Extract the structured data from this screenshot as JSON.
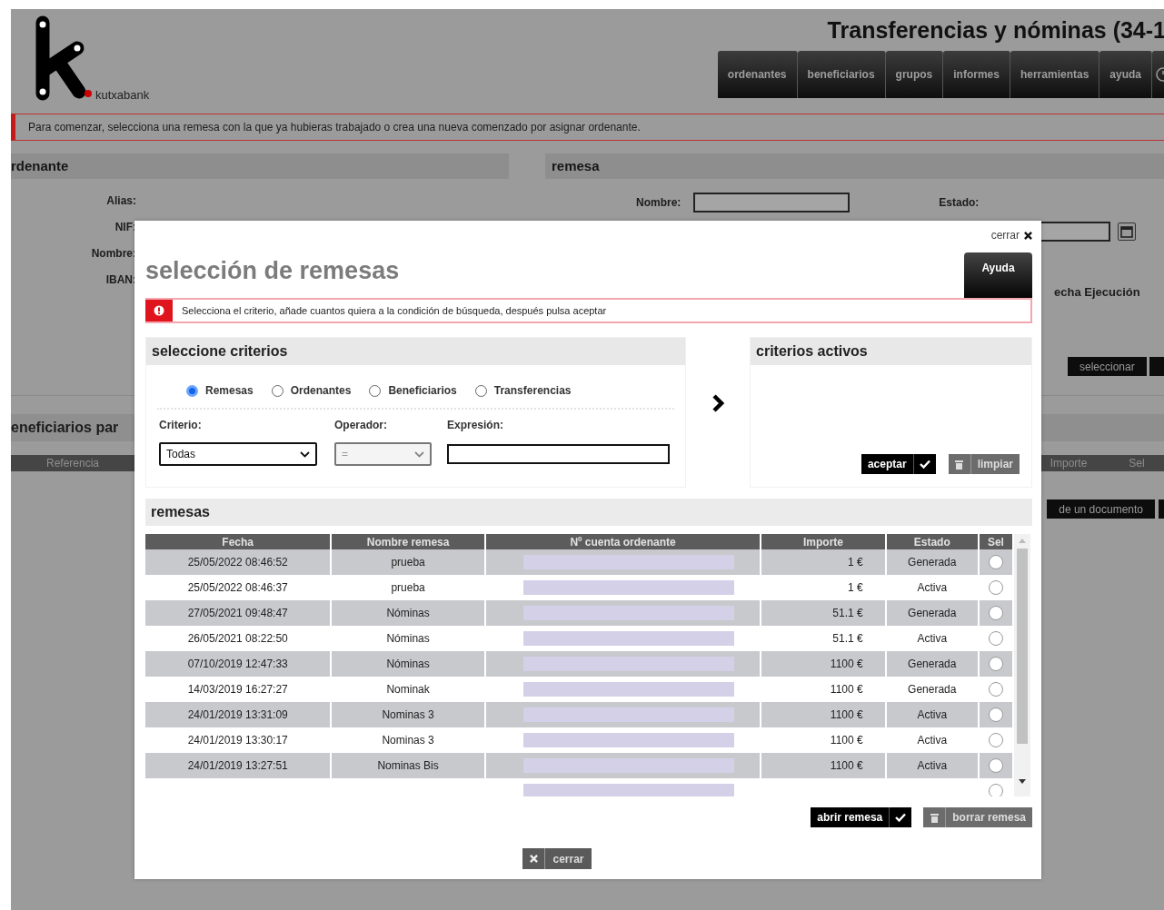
{
  "page": {
    "logo_text": "kutxabank",
    "title": "Transferencias y nóminas (34-1",
    "nav": [
      "ordenantes",
      "beneficiarios",
      "grupos",
      "informes",
      "herramientas",
      "ayuda"
    ],
    "notice": "Para comenzar, selecciona una remesa con la que ya hubieras trabajado o crea una nueva comenzado por asignar ordenante.",
    "ordenante": {
      "title": "rdenante",
      "labels": [
        "Alias:",
        "NIF:",
        "Nombre:",
        "IBAN:"
      ]
    },
    "remesa": {
      "title": "remesa",
      "nombre_label": "Nombre:",
      "estado_label": "Estado:",
      "fecha_label": "echa Ejecución",
      "button": "seleccionar"
    },
    "beneficiarios": {
      "title": "eneficiarios par",
      "columns": [
        "Referencia",
        "Importe",
        "Sel"
      ],
      "button": "de un documento"
    }
  },
  "dialog": {
    "close_link": "cerrar",
    "title": "selección de remesas",
    "help_button": "Ayuda",
    "alert": "Selecciona el criterio, añade cuantos quiera a la condición de búsqueda, después pulsa aceptar",
    "criteria": {
      "title": "seleccione criterios",
      "options": [
        {
          "label": "Remesas",
          "selected": true
        },
        {
          "label": "Ordenantes",
          "selected": false
        },
        {
          "label": "Beneficiarios",
          "selected": false
        },
        {
          "label": "Transferencias",
          "selected": false
        }
      ],
      "fields": [
        {
          "kind": "select",
          "label": "Criterio:",
          "value": "Todas",
          "disabled": false
        },
        {
          "kind": "select",
          "label": "Operador:",
          "value": "=",
          "disabled": true
        },
        {
          "kind": "text",
          "label": "Expresión:"
        }
      ]
    },
    "active": {
      "title": "criterios activos",
      "buttons": [
        {
          "kind": "confirm",
          "label": "aceptar"
        },
        {
          "kind": "delete",
          "label": "limpiar"
        }
      ]
    },
    "remesas": {
      "title": "remesas",
      "columns": [
        "Fecha",
        "Nombre remesa",
        "Nº cuenta ordenante",
        "Importe",
        "Estado",
        "Sel"
      ],
      "rows": [
        {
          "fecha": "25/05/2022 08:46:52",
          "nombre": "prueba",
          "importe": "1 €",
          "estado": "Generada",
          "selected": false
        },
        {
          "fecha": "25/05/2022 08:46:37",
          "nombre": "prueba",
          "importe": "1 €",
          "estado": "Activa",
          "selected": false
        },
        {
          "fecha": "27/05/2021 09:48:47",
          "nombre": "Nóminas",
          "importe": "51.1 €",
          "estado": "Generada",
          "selected": false
        },
        {
          "fecha": "26/05/2021 08:22:50",
          "nombre": "Nóminas",
          "importe": "51.1 €",
          "estado": "Activa",
          "selected": false
        },
        {
          "fecha": "07/10/2019 12:47:33",
          "nombre": "Nóminas",
          "importe": "1100 €",
          "estado": "Generada",
          "selected": false
        },
        {
          "fecha": "14/03/2019 16:27:27",
          "nombre": "Nominak",
          "importe": "1100 €",
          "estado": "Generada",
          "selected": false
        },
        {
          "fecha": "24/01/2019 13:31:09",
          "nombre": "Nominas 3",
          "importe": "1100 €",
          "estado": "Activa",
          "selected": false
        },
        {
          "fecha": "24/01/2019 13:30:17",
          "nombre": "Nominas 3",
          "importe": "1100 €",
          "estado": "Activa",
          "selected": false
        },
        {
          "fecha": "24/01/2019 13:27:51",
          "nombre": "Nominas Bis",
          "importe": "1100 €",
          "estado": "Activa",
          "selected": false
        },
        {
          "selected": false
        }
      ]
    },
    "buttons": [
      {
        "kind": "confirm",
        "label": "abrir remesa"
      },
      {
        "kind": "delete",
        "label": "borrar remesa"
      }
    ],
    "close_button": "cerrar"
  }
}
